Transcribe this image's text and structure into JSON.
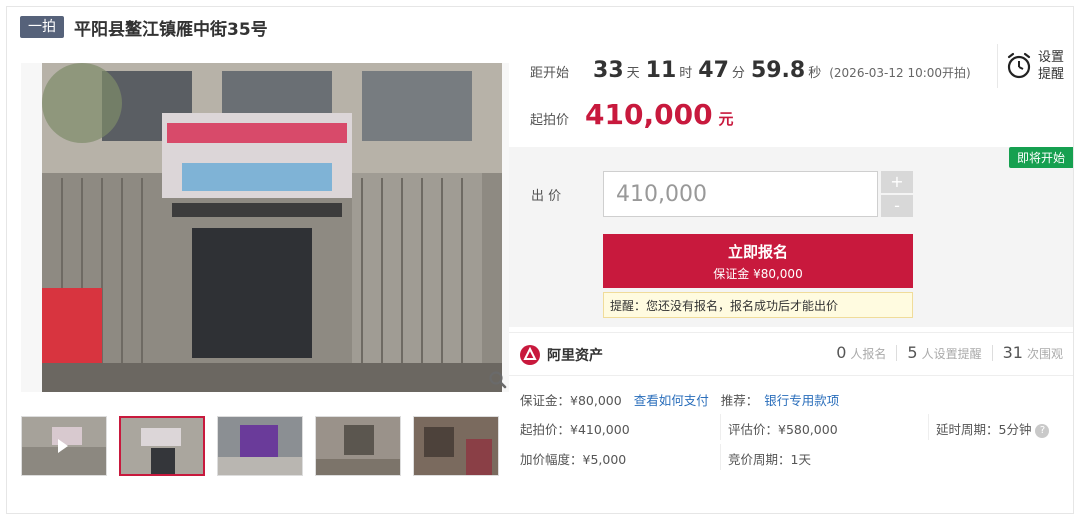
{
  "header": {
    "badge": "一拍",
    "title": "平阳县鳌江镇雁中街35号"
  },
  "icons": {
    "zoom": "magnifier-icon",
    "alarm": "alarm-clock-icon",
    "play": "play-icon",
    "brand": "aliasset-logo-icon",
    "help": "question-icon"
  },
  "countdown": {
    "label": "距开始",
    "days": "33",
    "days_unit": "天",
    "hours": "11",
    "hours_unit": "时",
    "minutes": "47",
    "minutes_unit": "分",
    "seconds": "59.8",
    "seconds_unit": "秒",
    "start_note": "(2026-03-12 10:00开拍)"
  },
  "reminder": {
    "line1": "设置",
    "line2": "提醒"
  },
  "start_price": {
    "label": "起拍价",
    "value": "410,000",
    "unit": "元"
  },
  "bid": {
    "status_tag": "即将开始",
    "label": "出 价",
    "input_value": "410,000",
    "plus": "+",
    "minus": "-",
    "signup_label": "立即报名",
    "signup_deposit": "保证金 ¥80,000",
    "reminder_text": "提醒：您还没有报名，报名成功后才能出价"
  },
  "brand": {
    "name": "阿里资产"
  },
  "stats": [
    {
      "num": "0",
      "label": "人报名"
    },
    {
      "num": "5",
      "label": "人设置提醒"
    },
    {
      "num": "31",
      "label": "次围观"
    }
  ],
  "details": {
    "deposit_label": "保证金：¥80,000",
    "how_to_pay": "查看如何支付",
    "recommend_label": "推荐：",
    "bank_loan": "银行专用款项",
    "start_price": "起拍价：¥410,000",
    "appraisal": "评估价：¥580,000",
    "extension": "延时周期：5分钟",
    "increment": "加价幅度：¥5,000",
    "cycle": "竞价周期：1天"
  },
  "colors": {
    "accent": "#c8193d",
    "status_green": "#16a050",
    "link": "#2a6ebb",
    "badge": "#56627a"
  }
}
